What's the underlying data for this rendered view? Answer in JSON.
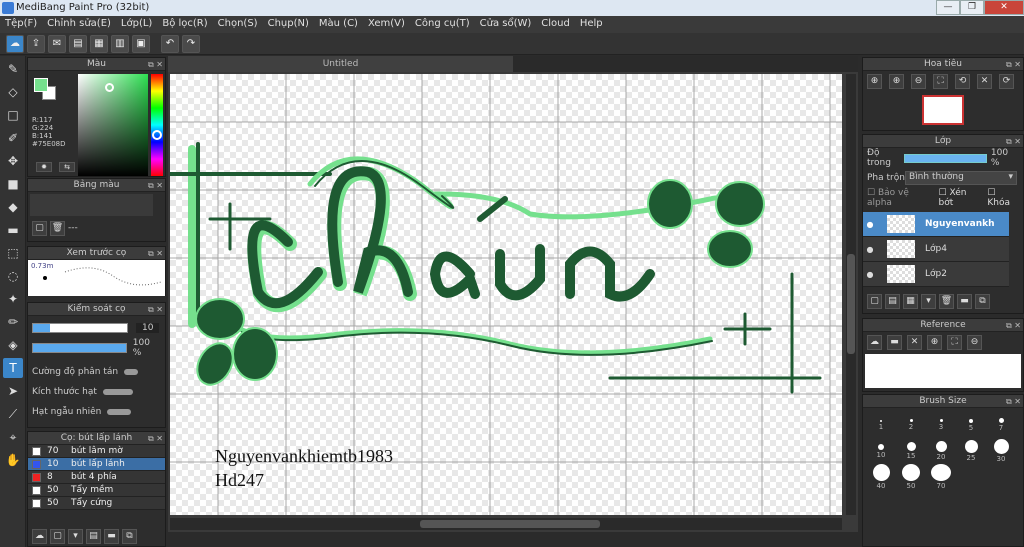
{
  "window": {
    "title": "MediBang Paint Pro (32bit)",
    "minimize": "—",
    "restore": "❐",
    "close": "✕"
  },
  "menu": [
    "Tệp(F)",
    "Chỉnh sửa(E)",
    "Lớp(L)",
    "Bộ lọc(R)",
    "Chọn(S)",
    "Chụp(N)",
    "Màu (C)",
    "Xem(V)",
    "Công cụ(T)",
    "Cửa sổ(W)",
    "Cloud",
    "Help"
  ],
  "toolbar_icons": [
    "cloud-icon",
    "share-icon",
    "comment-icon",
    "page-icon",
    "doc-icon",
    "grid-icon",
    "panels-icon",
    "undo-icon",
    "redo-icon"
  ],
  "color_panel": {
    "title": "Màu",
    "values": [
      "R:117",
      "G:224",
      "B:141",
      "#75E08D"
    ],
    "primary": "#75e08d",
    "secondary": "#ffffff"
  },
  "palette_panel": {
    "title": "Bảng màu",
    "dash": "---"
  },
  "preview_panel": {
    "title": "Xem trước cọ",
    "size": "0.73m"
  },
  "brush_control": {
    "title": "Kiểm soát cọ",
    "size_value": "10",
    "opacity_value": "100 %",
    "labels": [
      "Cường độ phân tán",
      "Kích thước hạt",
      "Hạt ngẫu nhiên"
    ]
  },
  "brush_list": {
    "title": "Cọ: bút lấp lánh",
    "items": [
      {
        "num": "70",
        "name": "bút lâm mờ",
        "color": "#ffffff"
      },
      {
        "num": "10",
        "name": "bút lấp lánh",
        "color": "#3355ee",
        "sel": true
      },
      {
        "num": "8",
        "name": "bút 4 phía",
        "color": "#ee2222"
      },
      {
        "num": "50",
        "name": "Tẩy mềm",
        "color": "#ffffff"
      },
      {
        "num": "50",
        "name": "Tẩy cứng",
        "color": "#ffffff"
      }
    ]
  },
  "document": {
    "tab": "Untitled",
    "credit_line1": "Nguyenvankhiemtb1983",
    "credit_line2": "Hd247",
    "artwork_text": "chàun"
  },
  "navigator": {
    "title": "Hoa tiêu"
  },
  "layer_panel": {
    "title": "Lớp",
    "opacity_label": "Độ trong",
    "opacity_value": "100 %",
    "opacity": 1.0,
    "blend_label": "Pha trộn",
    "blend_value": "Bình thường",
    "checks": [
      "Bảo vệ alpha",
      "Xén bớt",
      "Khóa"
    ],
    "layers": [
      {
        "name": "Nguyenvankh",
        "sel": true
      },
      {
        "name": "Lớp4"
      },
      {
        "name": "Lớp2"
      }
    ]
  },
  "reference_panel": {
    "title": "Reference"
  },
  "brush_size_panel": {
    "title": "Brush Size",
    "sizes": [
      "1",
      "2",
      "3",
      "5",
      "7",
      "10",
      "15",
      "20",
      "25",
      "30",
      "40",
      "50",
      "70"
    ]
  }
}
